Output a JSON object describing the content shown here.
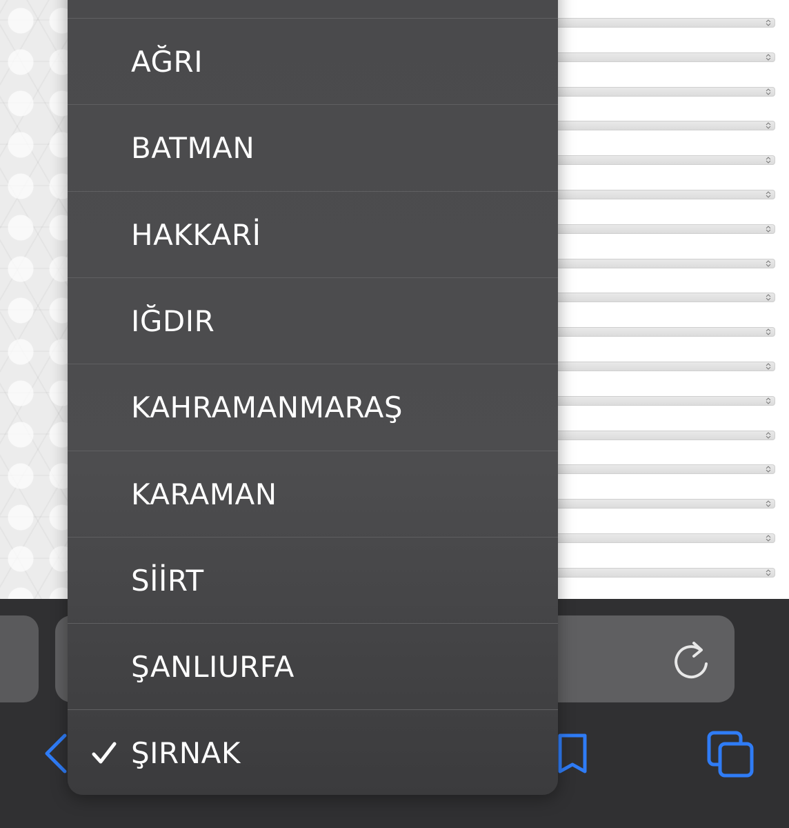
{
  "picker": {
    "options": [
      {
        "label": "AĞRI",
        "selected": false
      },
      {
        "label": "BATMAN",
        "selected": false
      },
      {
        "label": "HAKKARİ",
        "selected": false
      },
      {
        "label": "IĞDIR",
        "selected": false
      },
      {
        "label": "KAHRAMANMARAŞ",
        "selected": false
      },
      {
        "label": "KARAMAN",
        "selected": false
      },
      {
        "label": "SİİRT",
        "selected": false
      },
      {
        "label": "ŞANLIURFA",
        "selected": false
      },
      {
        "label": "ŞIRNAK",
        "selected": true
      }
    ],
    "selected_value": "ŞIRNAK",
    "check_icon": "checkmark-icon"
  },
  "toolbar": {
    "icons": [
      "reload-icon",
      "back-icon",
      "bookmarks-icon",
      "tabs-icon"
    ],
    "accent_color": "#2f7cf6"
  },
  "colors": {
    "picker_background": "#4b4b4d",
    "toolbar_background": "#303032",
    "address_bar": "#5f5f61",
    "text": "#ffffff"
  }
}
